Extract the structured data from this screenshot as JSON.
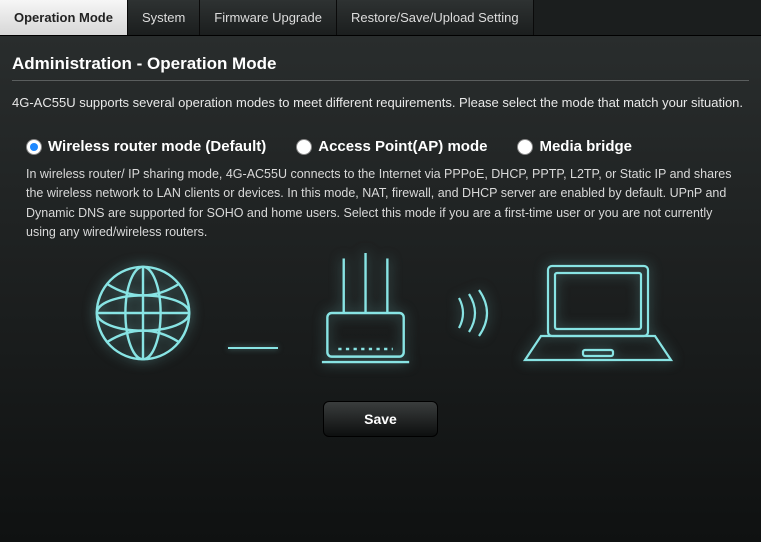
{
  "tabs": [
    {
      "label": "Operation Mode",
      "active": true
    },
    {
      "label": "System",
      "active": false
    },
    {
      "label": "Firmware Upgrade",
      "active": false
    },
    {
      "label": "Restore/Save/Upload Setting",
      "active": false
    }
  ],
  "page_title": "Administration - Operation Mode",
  "intro_text": "4G-AC55U supports several operation modes to meet different requirements. Please select the mode that match your situation.",
  "modes": [
    {
      "label": "Wireless router mode (Default)",
      "checked": true
    },
    {
      "label": "Access Point(AP) mode",
      "checked": false
    },
    {
      "label": "Media bridge",
      "checked": false
    }
  ],
  "mode_description": "In wireless router/ IP sharing mode, 4G-AC55U connects to the Internet via PPPoE, DHCP, PPTP, L2TP, or Static IP and shares the wireless network to LAN clients or devices. In this mode, NAT, firewall, and DHCP server are enabled by default. UPnP and Dynamic DNS are supported for SOHO and home users. Select this mode if you are a first-time user or you are not currently using any wired/wireless routers.",
  "save_button_label": "Save"
}
